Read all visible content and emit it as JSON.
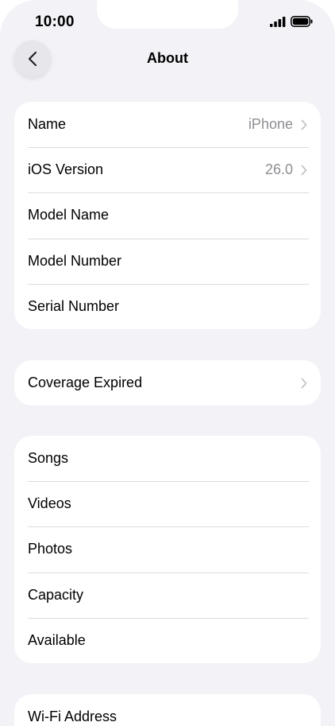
{
  "status_bar": {
    "time": "10:00"
  },
  "nav": {
    "title": "About"
  },
  "groups": {
    "device": [
      {
        "label": "Name",
        "value": "iPhone"
      },
      {
        "label": "iOS Version",
        "value": "26.0"
      },
      {
        "label": "Model Name"
      },
      {
        "label": "Model Number"
      },
      {
        "label": "Serial Number"
      }
    ],
    "coverage": [
      {
        "label": "Coverage Expired"
      }
    ],
    "storage": [
      {
        "label": "Songs"
      },
      {
        "label": "Videos"
      },
      {
        "label": "Photos"
      },
      {
        "label": "Capacity"
      },
      {
        "label": "Available"
      }
    ],
    "network": [
      {
        "label": "Wi-Fi Address"
      }
    ]
  },
  "colors": {
    "background": "#f2f2f7",
    "card": "#ffffff",
    "secondary_text": "#8e8e93",
    "chevron": "#c4c4c9"
  },
  "icons": {
    "back": "chevron-left-icon",
    "disclosure": "chevron-right-icon",
    "signal": "cellular-signal-icon",
    "battery": "battery-icon"
  }
}
